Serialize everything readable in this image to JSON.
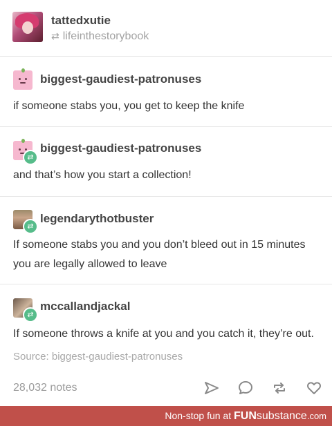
{
  "post": {
    "original_poster": "tattedxutie",
    "reblogged_from": "lifeinthestorybook",
    "replies": [
      {
        "username": "biggest-gaudiest-patronuses",
        "text": "if someone stabs you, you get to keep the knife"
      },
      {
        "username": "biggest-gaudiest-patronuses",
        "text": "and that’s how you start a collection!"
      },
      {
        "username": "legendarythotbuster",
        "text": "If someone stabs you and you don’t bleed out in 15 minutes you are legally allowed to leave"
      },
      {
        "username": "mccallandjackal",
        "text": "If someone throws a knife at you and you catch it, they’re out."
      }
    ],
    "source": "Source: biggest-gaudiest-patronuses",
    "notes": "28,032 notes"
  },
  "actions": {
    "share_icon": "send-icon",
    "reply_icon": "reply-bubble-icon",
    "reblog_icon": "reblog-icon",
    "like_icon": "heart-icon"
  },
  "footer": {
    "prefix": "Non-stop fun at ",
    "brand_bold": "FUN",
    "brand_light": "substance",
    "brand_suffix": ".com"
  },
  "colors": {
    "reblog_badge": "#56bc8a",
    "footer_bg": "#c0504a",
    "avatar_peach": "#f6b8cf"
  }
}
